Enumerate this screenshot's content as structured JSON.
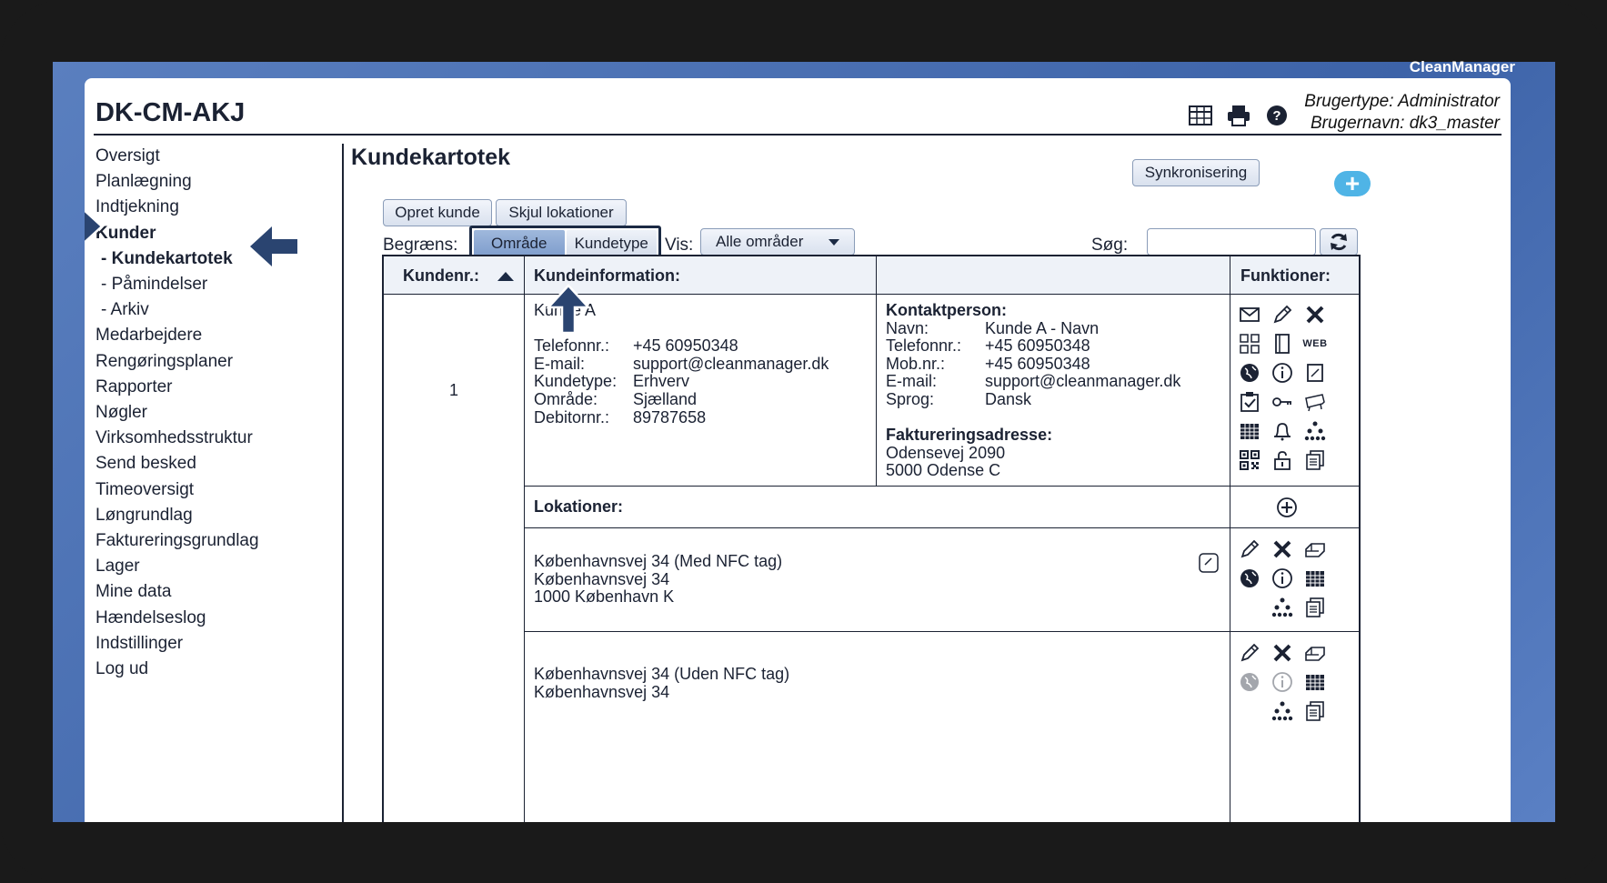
{
  "brand": "CleanManager",
  "site_title": "DK-CM-AKJ",
  "user": {
    "type": "Brugertype: Administrator",
    "name": "Brugernavn: dk3_master"
  },
  "header_icons": [
    "table-icon",
    "print-icon",
    "help-icon"
  ],
  "sidebar": {
    "items": [
      {
        "label": "Oversigt"
      },
      {
        "label": "Planlægning"
      },
      {
        "label": "Indtjekning"
      },
      {
        "label": "Kunder"
      },
      {
        "label": "- Kundekartotek"
      },
      {
        "label": "- Påmindelser"
      },
      {
        "label": "- Arkiv"
      },
      {
        "label": "Medarbejdere"
      },
      {
        "label": "Rengøringsplaner"
      },
      {
        "label": "Rapporter"
      },
      {
        "label": "Nøgler"
      },
      {
        "label": "Virksomhedsstruktur"
      },
      {
        "label": "Send besked"
      },
      {
        "label": "Timeoversigt"
      },
      {
        "label": "Løngrundlag"
      },
      {
        "label": "Faktureringsgrundlag"
      },
      {
        "label": "Lager"
      },
      {
        "label": "Mine data"
      },
      {
        "label": "Hændelseslog"
      },
      {
        "label": "Indstillinger"
      },
      {
        "label": "Log ud"
      }
    ]
  },
  "main": {
    "title": "Kundekartotek",
    "sync_label": "Synkronisering",
    "create_label": "Opret kunde",
    "hide_locations_label": "Skjul lokationer",
    "limit_label": "Begræns:",
    "seg_area": "Område",
    "seg_type": "Kundetype",
    "show_label": "Vis:",
    "show_value": "Alle områder",
    "search_label": "Søg:",
    "search_value": ""
  },
  "table": {
    "headers": {
      "customer_no": "Kundenr.:",
      "info": "Kundeinformation:",
      "functions": "Funktioner:"
    },
    "customer": {
      "number": "1",
      "name": "Kunde A",
      "fields": [
        {
          "k": "Telefonnr.:",
          "v": "+45 60950348"
        },
        {
          "k": "E-mail:",
          "v": "support@cleanmanager.dk"
        },
        {
          "k": "Kundetype:",
          "v": "Erhverv"
        },
        {
          "k": "Område:",
          "v": "Sjælland"
        },
        {
          "k": "Debitornr.:",
          "v": "89787658"
        }
      ],
      "contact_title": "Kontaktperson:",
      "contact": [
        {
          "k": "Navn:",
          "v": "Kunde A - Navn"
        },
        {
          "k": "Telefonnr.:",
          "v": "+45 60950348"
        },
        {
          "k": "Mob.nr.:",
          "v": "+45 60950348"
        },
        {
          "k": "E-mail:",
          "v": "support@cleanmanager.dk"
        },
        {
          "k": "Sprog:",
          "v": "Dansk"
        }
      ],
      "billing_title": "Faktureringsadresse:",
      "billing": [
        "Odensevej 2090",
        "5000 Odense C"
      ]
    },
    "locations_title": "Lokationer:",
    "locations": [
      {
        "lines": [
          "Københavnsvej 34 (Med NFC tag)",
          "Københavnsvej 34",
          "1000 København K"
        ]
      },
      {
        "lines": [
          "Københavnsvej 34 (Uden NFC tag)",
          "Københavnsvej 34"
        ]
      }
    ],
    "web_label": "WEB"
  },
  "colors": {
    "accent": "#4fb4e6",
    "navy": "#1b2a44",
    "screen_blue": "#3d63a8"
  }
}
